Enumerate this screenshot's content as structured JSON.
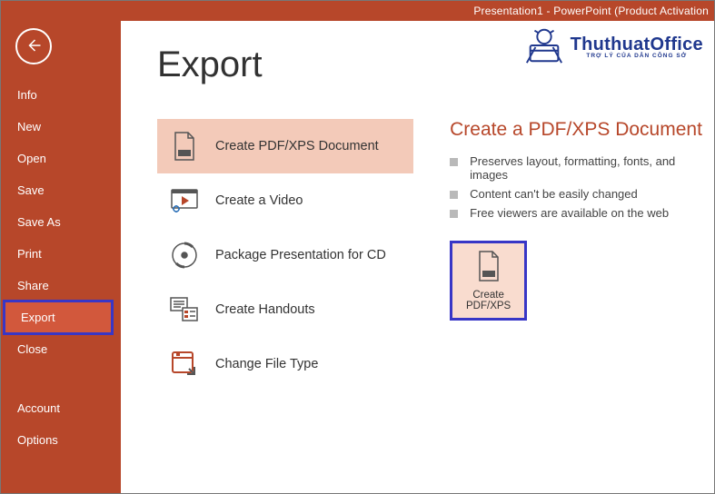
{
  "titlebar": "Presentation1 - PowerPoint (Product Activation",
  "page_title": "Export",
  "sidebar": {
    "items": [
      {
        "label": "Info"
      },
      {
        "label": "New"
      },
      {
        "label": "Open"
      },
      {
        "label": "Save"
      },
      {
        "label": "Save As"
      },
      {
        "label": "Print"
      },
      {
        "label": "Share"
      },
      {
        "label": "Export"
      },
      {
        "label": "Close"
      }
    ],
    "footer": [
      {
        "label": "Account"
      },
      {
        "label": "Options"
      }
    ],
    "selected_index": 7
  },
  "export_options": [
    {
      "label": "Create PDF/XPS Document",
      "icon": "pdf-file-icon"
    },
    {
      "label": "Create a Video",
      "icon": "video-icon"
    },
    {
      "label": "Package Presentation for CD",
      "icon": "cd-icon"
    },
    {
      "label": "Create Handouts",
      "icon": "handout-icon"
    },
    {
      "label": "Change File Type",
      "icon": "change-file-icon"
    }
  ],
  "export_selected_index": 0,
  "right_panel": {
    "title": "Create a PDF/XPS Document",
    "bullets": [
      "Preserves layout, formatting, fonts, and images",
      "Content can't be easily changed",
      "Free viewers are available on the web"
    ],
    "button": {
      "line1": "Create",
      "line2": "PDF/XPS"
    }
  },
  "watermark": {
    "main": "ThuthuatOffice",
    "sub": "TRỢ LÝ CỦA DÂN CÔNG SỞ"
  },
  "colors": {
    "accent": "#b7472a",
    "accent_light": "#f3cab9",
    "highlight_border": "#3836c6"
  }
}
